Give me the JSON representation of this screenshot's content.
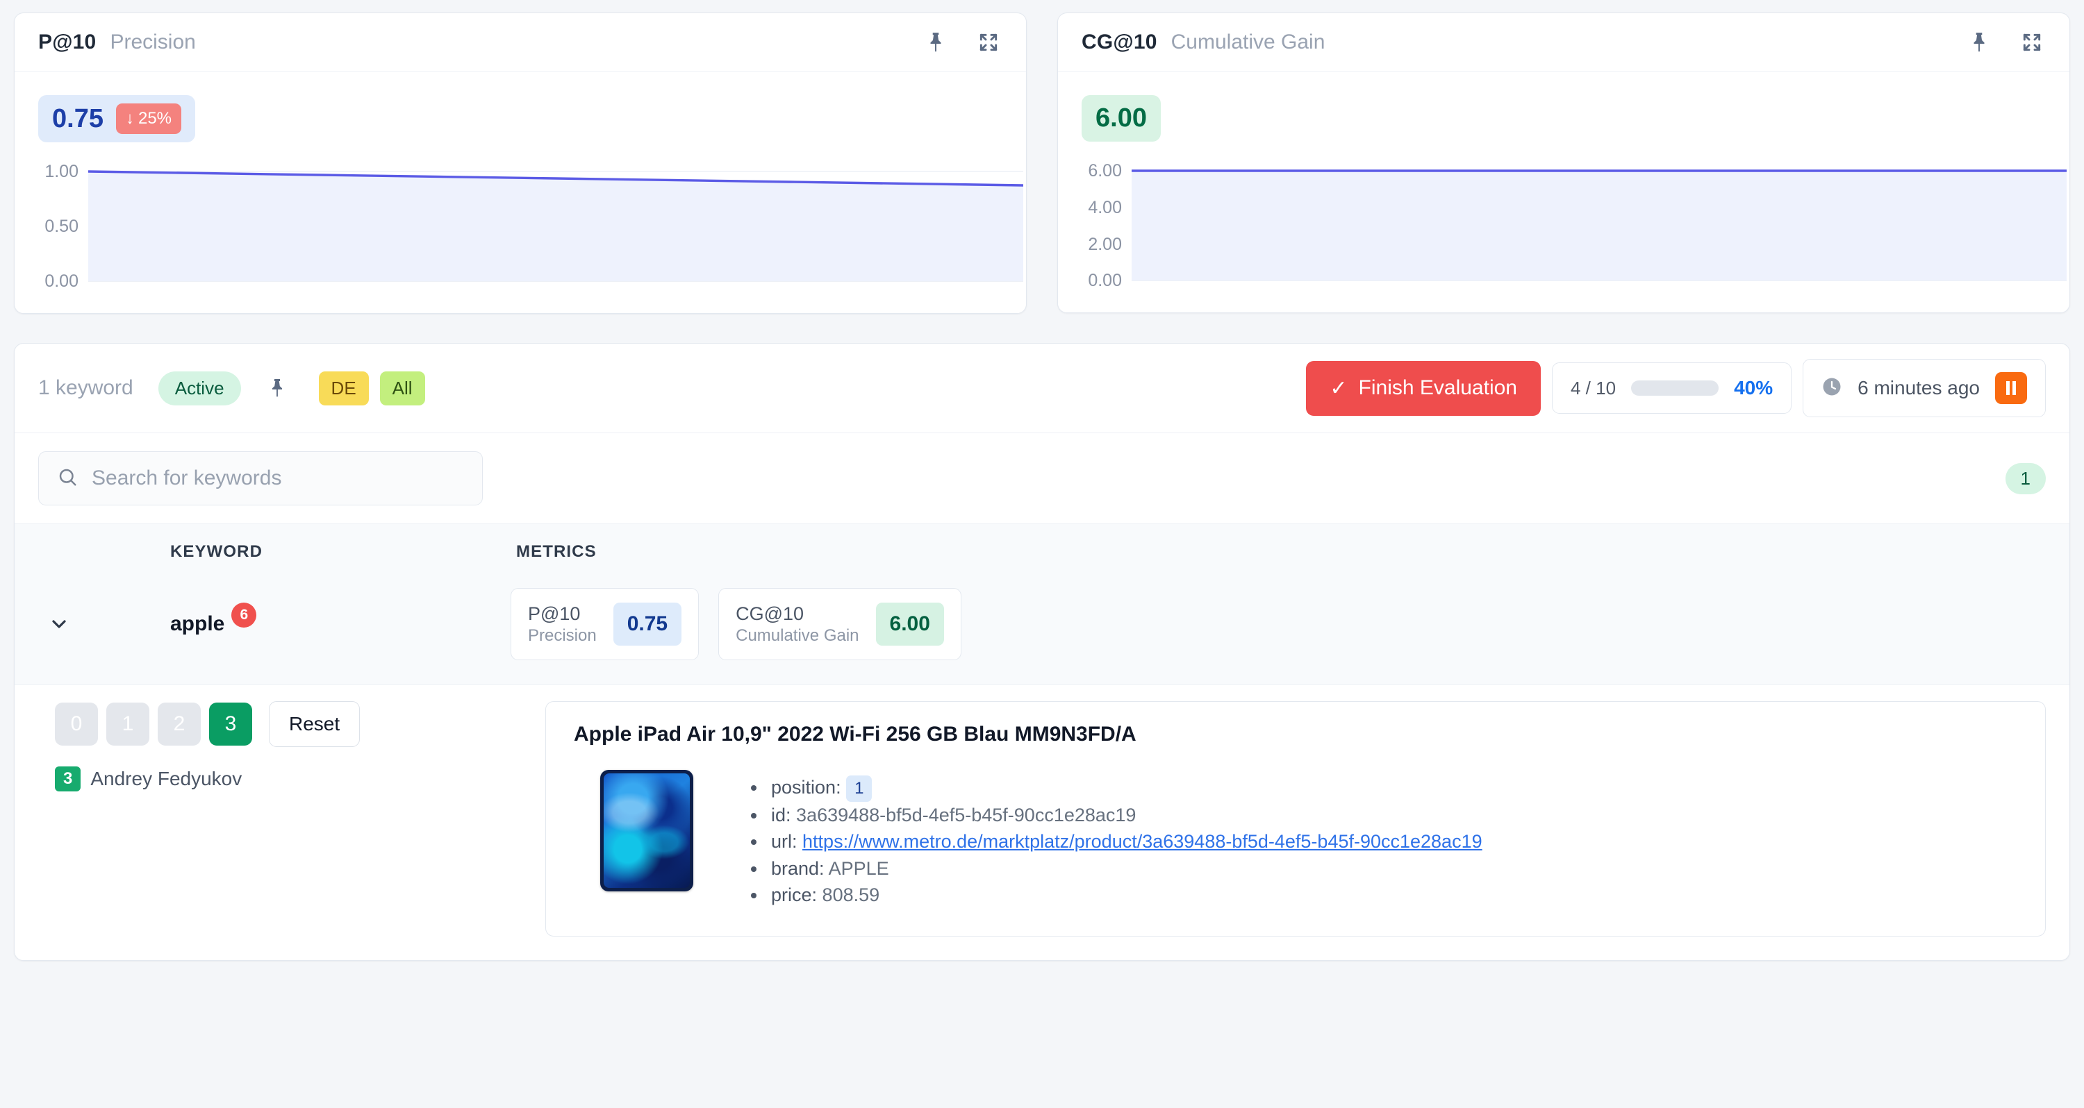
{
  "cards": [
    {
      "key": "P@10",
      "name": "Precision",
      "value": "0.75",
      "delta": "25%",
      "delta_dir": "down",
      "pin_icon": "pin-icon",
      "expand_icon": "expand-icon",
      "value_color": "#1d3fa8",
      "value_bg": "#e0ebfb",
      "delta_bg": "#f4827e"
    },
    {
      "key": "CG@10",
      "name": "Cumulative Gain",
      "value": "6.00",
      "delta": "",
      "delta_dir": "",
      "pin_icon": "pin-icon",
      "expand_icon": "expand-icon",
      "value_color": "#046c45",
      "value_bg": "#d9f3e4"
    }
  ],
  "toolbar": {
    "keyword_count": "1 keyword",
    "status_chip": "Active",
    "pin_icon": "pin-icon",
    "tags": [
      "DE",
      "All"
    ],
    "finish_label": "Finish Evaluation",
    "finish_color": "#ef4d4d",
    "check_icon": "check-icon",
    "progress_label": "4 / 10",
    "progress_pct": "40%",
    "progress_value": 40,
    "clock_icon": "clock-icon",
    "time_text": "6 minutes ago",
    "pause_icon": "pause-icon",
    "pause_color": "#f96a10"
  },
  "search": {
    "placeholder": "Search for keywords",
    "value": "",
    "icon": "search-icon",
    "result_count": "1"
  },
  "table": {
    "headers": [
      "KEYWORD",
      "METRICS"
    ],
    "row": {
      "chevron_icon": "chevron-down-icon",
      "keyword": "apple",
      "badge": "6",
      "badge_color": "#f0504d",
      "metrics": [
        {
          "key": "P@10",
          "sub": "Precision",
          "value": "0.75",
          "tone": "blue"
        },
        {
          "key": "CG@10",
          "sub": "Cumulative Gain",
          "value": "6.00",
          "tone": "green"
        }
      ]
    }
  },
  "rating": {
    "options": [
      "0",
      "1",
      "2",
      "3"
    ],
    "selected": "3",
    "reset_label": "Reset",
    "rater_score": "3",
    "rater_name": "Andrey Fedyukov",
    "selected_color": "#0a9d63"
  },
  "document": {
    "title": "Apple iPad Air 10,9\" 2022 Wi-Fi 256 GB Blau MM9N3FD/A",
    "thumbnail": "ipad-air-blue-thumbnail",
    "meta": [
      {
        "key": "position:",
        "value": "1",
        "type": "badge"
      },
      {
        "key": "id:",
        "value": "3a639488-bf5d-4ef5-b45f-90cc1e28ac19",
        "type": "text"
      },
      {
        "key": "url:",
        "value": "https://www.metro.de/marktplatz/product/3a639488-bf5d-4ef5-b45f-90cc1e28ac19",
        "type": "link"
      },
      {
        "key": "brand:",
        "value": "APPLE",
        "type": "text"
      },
      {
        "key": "price:",
        "value": "808.59",
        "type": "text"
      }
    ]
  },
  "chart_data": [
    {
      "type": "line",
      "title": "P@10 Precision",
      "x": [
        0,
        1,
        2,
        3,
        4
      ],
      "values": [
        1.0,
        0.97,
        0.94,
        0.91,
        0.87
      ],
      "yticks": [
        "1.00",
        "0.50",
        "0.00"
      ],
      "ylim": [
        0,
        1.15
      ],
      "xlabel": "",
      "ylabel": "",
      "grid": true,
      "legend": "none",
      "line_color": "#5b5be6",
      "area_color": "#eef2fd"
    },
    {
      "type": "line",
      "title": "CG@10 Cumulative Gain",
      "x": [
        0,
        1,
        2,
        3,
        4
      ],
      "values": [
        6.0,
        6.0,
        6.0,
        6.0,
        6.0
      ],
      "yticks": [
        "6.00",
        "4.00",
        "2.00",
        "0.00"
      ],
      "ylim": [
        0,
        6.9
      ],
      "xlabel": "",
      "ylabel": "",
      "grid": true,
      "legend": "none",
      "line_color": "#5b5be6",
      "area_color": "#eef2fd"
    }
  ]
}
